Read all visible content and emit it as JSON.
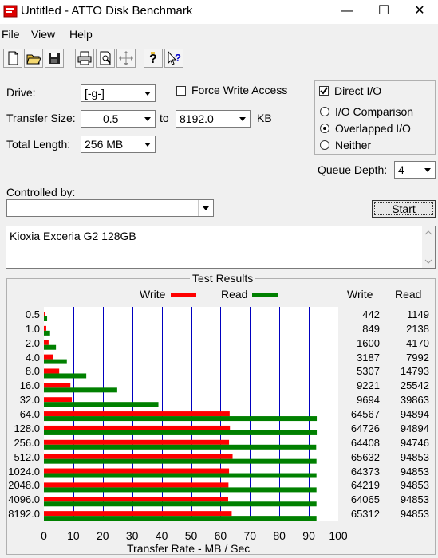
{
  "window": {
    "title": "Untitled - ATTO Disk Benchmark",
    "minimize": "—",
    "maximize": "☐",
    "close": "✕"
  },
  "menu": {
    "file": "File",
    "view": "View",
    "help": "Help"
  },
  "toolbar": {
    "icons": [
      "new-icon",
      "open-icon",
      "save-icon",
      "print-icon",
      "print-preview-icon",
      "move-icon",
      "help-icon",
      "context-help-icon"
    ]
  },
  "form": {
    "drive_label": "Drive:",
    "drive_value": "[-g-]",
    "force_write_label": "Force Write Access",
    "force_write_checked": false,
    "direct_io_label": "Direct I/O",
    "direct_io_checked": true,
    "transfer_size_label": "Transfer Size:",
    "transfer_from": "0.5",
    "to_label": "to",
    "transfer_to": "8192.0",
    "kb_label": "KB",
    "total_length_label": "Total Length:",
    "total_length_value": "256 MB",
    "io_comparison_label": "I/O Comparison",
    "overlapped_io_label": "Overlapped I/O",
    "neither_label": "Neither",
    "selected_mode": "Overlapped I/O",
    "queue_depth_label": "Queue Depth:",
    "queue_depth_value": "4",
    "controlled_by_label": "Controlled by:",
    "controlled_by_value": "",
    "start_label": "Start",
    "description": "Kioxia Exceria G2 128GB"
  },
  "results": {
    "title": "Test Results",
    "write_legend": "Write",
    "read_legend": "Read",
    "write_col": "Write",
    "read_col": "Read",
    "write_color": "#ff0000",
    "read_color": "#008000",
    "grid_color": "#0000c0"
  },
  "chart_data": {
    "type": "bar",
    "orientation": "horizontal",
    "title": "Test Results",
    "xlabel": "Transfer Rate - MB / Sec",
    "xlim": [
      0,
      100
    ],
    "xticks": [
      "0",
      "10",
      "20",
      "30",
      "40",
      "50",
      "60",
      "70",
      "80",
      "90",
      "100"
    ],
    "categories": [
      "0.5",
      "1.0",
      "2.0",
      "4.0",
      "8.0",
      "16.0",
      "32.0",
      "64.0",
      "128.0",
      "256.0",
      "512.0",
      "1024.0",
      "2048.0",
      "4096.0",
      "8192.0"
    ],
    "series": [
      {
        "name": "Write",
        "values": [
          0.4,
          0.8,
          1.6,
          3.1,
          5.2,
          9.0,
          9.5,
          63.1,
          63.2,
          62.9,
          64.1,
          62.9,
          62.7,
          62.6,
          63.8
        ],
        "labels": [
          "442",
          "849",
          "1600",
          "3187",
          "5307",
          "9221",
          "9694",
          "64567",
          "64726",
          "64408",
          "65632",
          "64373",
          "64219",
          "64065",
          "65312"
        ]
      },
      {
        "name": "Read",
        "values": [
          1.1,
          2.1,
          4.1,
          7.8,
          14.4,
          24.9,
          38.9,
          92.7,
          92.7,
          92.5,
          92.6,
          92.6,
          92.6,
          92.6,
          92.6
        ],
        "labels": [
          "1149",
          "2138",
          "4170",
          "7992",
          "14793",
          "25542",
          "39863",
          "94894",
          "94894",
          "94746",
          "94853",
          "94853",
          "94853",
          "94853",
          "94853"
        ]
      }
    ]
  }
}
